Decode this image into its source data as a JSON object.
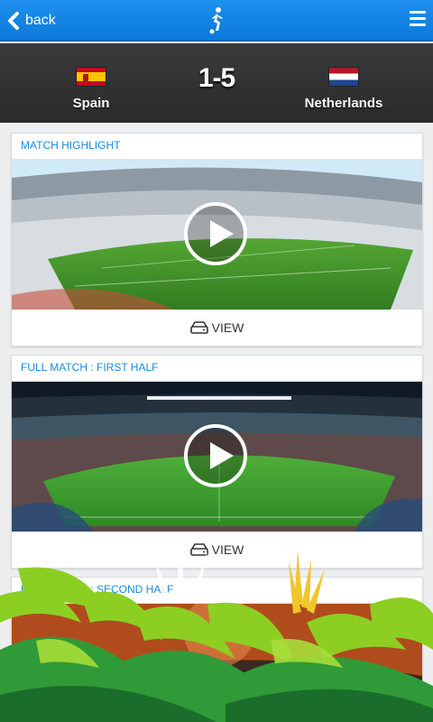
{
  "header": {
    "back_label": "back",
    "logo_icon": "soccer-player-icon",
    "menu_icon": "hamburger-menu-icon"
  },
  "match": {
    "home_team": "Spain",
    "away_team": "Netherlands",
    "score": "1-5"
  },
  "videos": [
    {
      "title": "MATCH HIGHLIGHT",
      "action_label": "VIEW"
    },
    {
      "title": "FULL MATCH : FIRST HALF",
      "action_label": "VIEW"
    },
    {
      "title": "FULL MATCH : SECOND HALF"
    }
  ],
  "colors": {
    "topbar": "#0c79d8",
    "scorebar": "#2e2e2e",
    "accent_text": "#1a8ae0"
  }
}
